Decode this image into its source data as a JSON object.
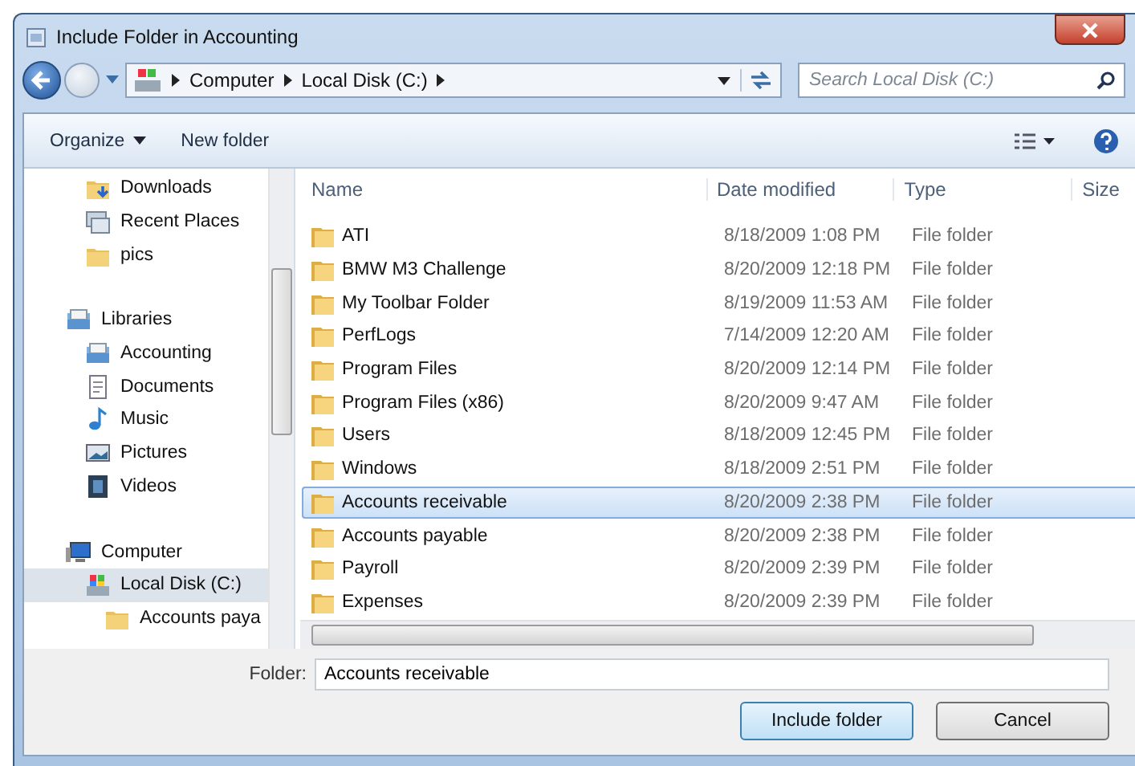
{
  "window": {
    "title": "Include Folder in Accounting"
  },
  "address": {
    "crumbs": [
      "Computer",
      "Local Disk (C:)"
    ]
  },
  "search": {
    "placeholder": "Search Local Disk (C:)"
  },
  "toolbar": {
    "buttons": [
      "Organize",
      "New folder"
    ]
  },
  "sidebar": {
    "items": [
      {
        "label": "Downloads",
        "kind": "downloads",
        "selected": false
      },
      {
        "label": "Recent Places",
        "kind": "recent",
        "selected": false
      },
      {
        "label": "pics",
        "kind": "folder",
        "selected": false
      },
      {
        "label": "Libraries",
        "kind": "library",
        "selected": false,
        "children": [
          {
            "label": "Accounting",
            "kind": "library",
            "selected": false
          },
          {
            "label": "Documents",
            "kind": "documents",
            "selected": false
          },
          {
            "label": "Music",
            "kind": "music",
            "selected": false
          },
          {
            "label": "Pictures",
            "kind": "pictures",
            "selected": false
          },
          {
            "label": "Videos",
            "kind": "videos",
            "selected": false
          }
        ]
      },
      {
        "label": "Computer",
        "kind": "computer",
        "selected": false,
        "children": [
          {
            "label": "Local Disk (C:)",
            "kind": "drive",
            "selected": true,
            "children": [
              {
                "label": "Accounts paya",
                "kind": "folder",
                "selected": false
              }
            ]
          }
        ]
      }
    ]
  },
  "table": {
    "columns": [
      "Name",
      "Date modified",
      "Type",
      "Size"
    ],
    "rows": [
      {
        "name": "ATI",
        "date": "8/18/2009 1:08 PM",
        "type": "File folder",
        "selected": false
      },
      {
        "name": "BMW M3 Challenge",
        "date": "8/20/2009 12:18 PM",
        "type": "File folder",
        "selected": false
      },
      {
        "name": "My Toolbar Folder",
        "date": "8/19/2009 11:53 AM",
        "type": "File folder",
        "selected": false
      },
      {
        "name": "PerfLogs",
        "date": "7/14/2009 12:20 AM",
        "type": "File folder",
        "selected": false
      },
      {
        "name": "Program Files",
        "date": "8/20/2009 12:14 PM",
        "type": "File folder",
        "selected": false
      },
      {
        "name": "Program Files (x86)",
        "date": "8/20/2009 9:47 AM",
        "type": "File folder",
        "selected": false
      },
      {
        "name": "Users",
        "date": "8/18/2009 12:45 PM",
        "type": "File folder",
        "selected": false
      },
      {
        "name": "Windows",
        "date": "8/18/2009 2:51 PM",
        "type": "File folder",
        "selected": false
      },
      {
        "name": "Accounts receivable",
        "date": "8/20/2009 2:38 PM",
        "type": "File folder",
        "selected": true
      },
      {
        "name": "Accounts payable",
        "date": "8/20/2009 2:38 PM",
        "type": "File folder",
        "selected": false
      },
      {
        "name": "Payroll",
        "date": "8/20/2009 2:39 PM",
        "type": "File folder",
        "selected": false
      },
      {
        "name": "Expenses",
        "date": "8/20/2009 2:39 PM",
        "type": "File folder",
        "selected": false
      }
    ]
  },
  "folder_field": {
    "label": "Folder:",
    "value": "Accounts receivable"
  },
  "buttons": [
    "Include folder",
    "Cancel"
  ]
}
